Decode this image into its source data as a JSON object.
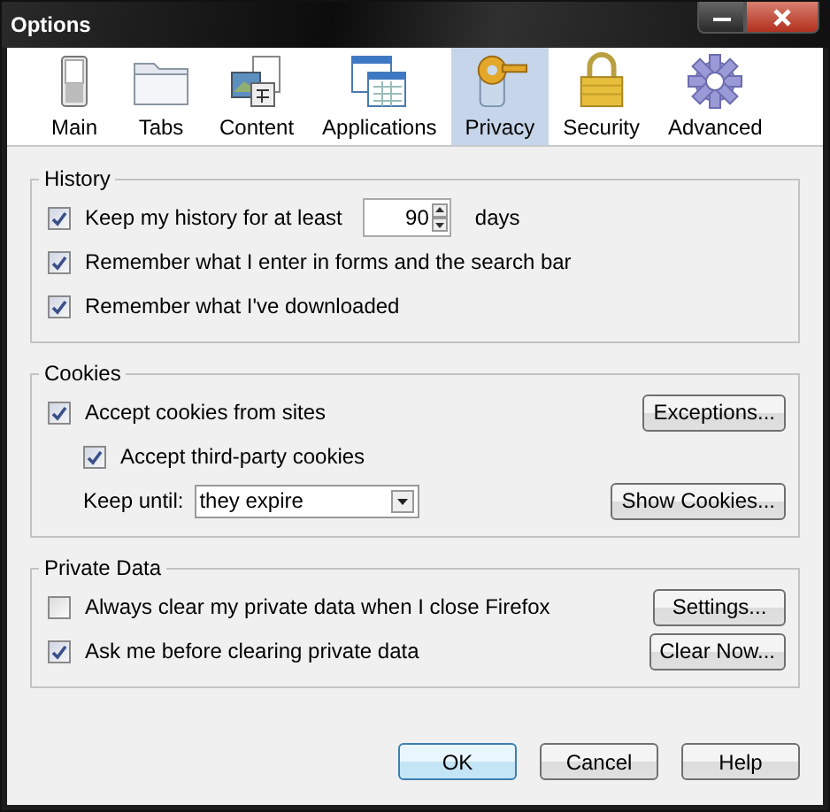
{
  "window": {
    "title": "Options"
  },
  "panes": [
    {
      "label": "Main",
      "selected": false
    },
    {
      "label": "Tabs",
      "selected": false
    },
    {
      "label": "Content",
      "selected": false
    },
    {
      "label": "Applications",
      "selected": false
    },
    {
      "label": "Privacy",
      "selected": true
    },
    {
      "label": "Security",
      "selected": false
    },
    {
      "label": "Advanced",
      "selected": false
    }
  ],
  "groups": [
    {
      "title": "History",
      "rows": [
        {
          "kind": "checkbox",
          "label": "Keep my history for at least",
          "checked": true,
          "spinner": {
            "value": "90",
            "unit": "days"
          }
        },
        {
          "kind": "checkbox",
          "label": "Remember what I enter in forms and the search bar",
          "checked": true
        },
        {
          "kind": "checkbox",
          "label": "Remember what I've downloaded",
          "checked": true
        }
      ]
    },
    {
      "title": "Cookies",
      "rows": [
        {
          "kind": "checkbox",
          "label": "Accept cookies from sites",
          "checked": true,
          "button": "Exceptions...",
          "children": [
            {
              "kind": "checkbox",
              "label": "Accept third-party cookies",
              "checked": true
            },
            {
              "kind": "select",
              "label": "Keep until:",
              "value": "they expire",
              "button": "Show Cookies..."
            }
          ]
        }
      ]
    },
    {
      "title": "Private Data",
      "rows": [
        {
          "kind": "checkbox",
          "label": "Always clear my private data when I close Firefox",
          "checked": false,
          "button": "Settings..."
        },
        {
          "kind": "checkbox",
          "label": "Ask me before clearing private data",
          "checked": true,
          "button": "Clear Now..."
        }
      ]
    }
  ],
  "buttons": [
    {
      "label": "OK",
      "default": true
    },
    {
      "label": "Cancel",
      "default": false
    },
    {
      "label": "Help",
      "default": false
    }
  ]
}
